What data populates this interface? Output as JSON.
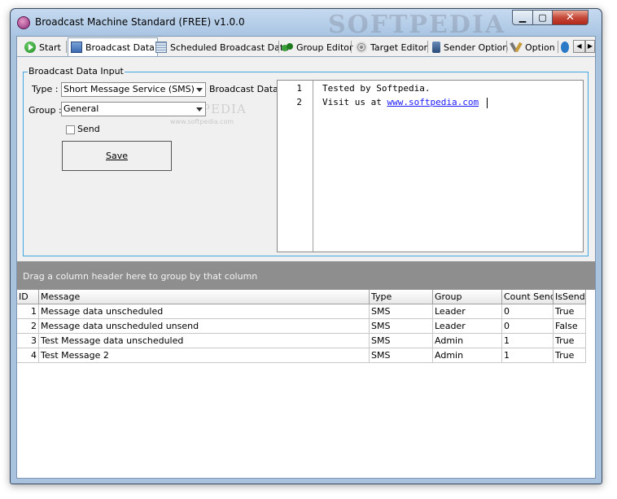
{
  "window": {
    "title": "Broadcast Machine Standard (FREE) v1.0.0",
    "watermark": "SOFTPEDIA",
    "minimize_glyph": "▁",
    "maximize_glyph": "▢",
    "close_glyph": "✕"
  },
  "tabs": [
    {
      "label": "Start",
      "icon": "start-icon"
    },
    {
      "label": "Broadcast Data",
      "icon": "broadcast-data-icon"
    },
    {
      "label": "Scheduled Broadcast Data",
      "icon": "grid-icon"
    },
    {
      "label": "Group Editor",
      "icon": "group-icon"
    },
    {
      "label": "Target Editor",
      "icon": "target-icon"
    },
    {
      "label": "Sender Option",
      "icon": "sender-icon"
    },
    {
      "label": "Option",
      "icon": "option-icon"
    }
  ],
  "tab_scroll": {
    "left": "◀",
    "right": "▶"
  },
  "form": {
    "groupbox_label": "Broadcast Data Input",
    "type_label": "Type :",
    "type_value": "Short Message Service (SMS)",
    "group_label": "Group :",
    "group_value": "General",
    "send_label": "Send",
    "send_checked": false,
    "save_label": "Save",
    "broadcast_data_label": "Broadcast Data :",
    "softpedia_wm": "SOFTPEDIA",
    "softpedia_wm_small": "www.softpedia.com"
  },
  "editor": {
    "line_numbers": [
      "1",
      "2"
    ],
    "line1": "Tested by Softpedia.",
    "line2_prefix": "Visit us at ",
    "line2_link": "www.softpedia.com"
  },
  "grid": {
    "group_hint": "Drag a column header here to group by that column",
    "columns": [
      "ID",
      "Message",
      "Type",
      "Group",
      "Count Send",
      "IsSend"
    ],
    "rows": [
      {
        "id": "1",
        "message": "Message data unscheduled",
        "type": "SMS",
        "group": "Leader",
        "count": "0",
        "issend": "True"
      },
      {
        "id": "2",
        "message": "Message data unscheduled unsend",
        "type": "SMS",
        "group": "Leader",
        "count": "0",
        "issend": "False"
      },
      {
        "id": "3",
        "message": "Test Message data unscheduled",
        "type": "SMS",
        "group": "Admin",
        "count": "1",
        "issend": "True"
      },
      {
        "id": "4",
        "message": "Test Message 2",
        "type": "SMS",
        "group": "Admin",
        "count": "1",
        "issend": "True"
      }
    ]
  },
  "colors": {
    "accent_border": "#3fa6e0",
    "link": "#1a1aff",
    "group_area": "#8e8e8e"
  }
}
